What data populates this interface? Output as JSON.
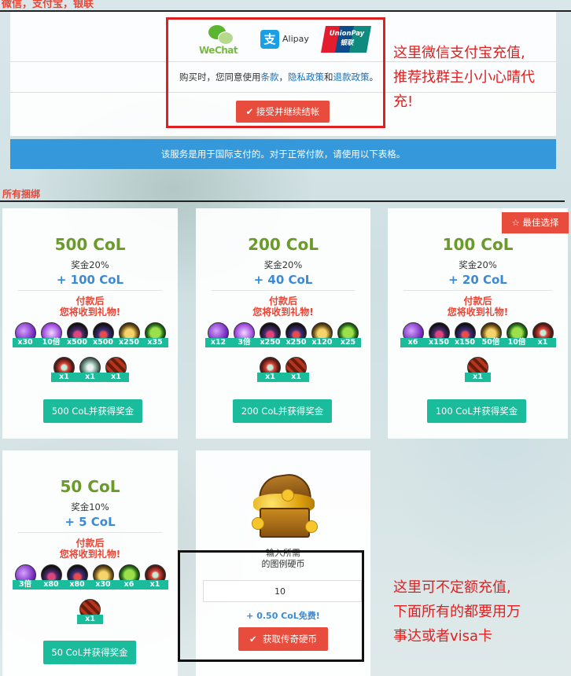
{
  "topbar": {
    "methods": "微信，支付宝，银联",
    "user": "",
    "nav": ""
  },
  "payment": {
    "logos": {
      "wechat": "WeChat",
      "alipay": "Alipay",
      "unionpay_en": "UnionPay",
      "unionpay_cn": "银联",
      "alipay_glyph": "支"
    },
    "agree_prefix": "购买时，您同意使用",
    "terms": "条款",
    "sep1": "，",
    "privacy": "隐私政策",
    "and": "和",
    "refund": "退款政策",
    "period": "。",
    "accept_button": "接受并继续结帐",
    "check_icon": "✔"
  },
  "annotations": {
    "top_line1": "这里微信支付宝充值,",
    "top_line2": "推荐找群主小小心晴代",
    "top_line3": "充!",
    "bottom_line1": "这里可不定额充值,",
    "bottom_line2": "下面所有的都要用万",
    "bottom_line3": "事达或者visa卡"
  },
  "notice": "该服务是用于国际支付的。对于正常付款，请使用以下表格。",
  "section_title": "所有捆绑",
  "best_choice": {
    "icon": "☆",
    "label": "最佳选择"
  },
  "gift_text_line1": "付款后",
  "gift_text_line2": "您将收到礼物!",
  "bundles": [
    {
      "col": "500 CoL",
      "bonus": "奖金20%",
      "plus": "+ 100 CoL",
      "buy": "500 CoL并获得奖金",
      "row1": [
        {
          "icon": "purple",
          "qty": "x30"
        },
        {
          "icon": "purple2",
          "qty": "10倍"
        },
        {
          "icon": "potion",
          "qty": "x500"
        },
        {
          "icon": "potion2",
          "qty": "x500"
        },
        {
          "icon": "cup",
          "qty": "x250"
        },
        {
          "icon": "leaf",
          "qty": "x35"
        }
      ],
      "row2": [
        {
          "icon": "scroll",
          "qty": "x1"
        },
        {
          "icon": "swirl",
          "qty": "x1"
        },
        {
          "icon": "bar",
          "qty": "x1"
        }
      ]
    },
    {
      "col": "200 CoL",
      "bonus": "奖金20%",
      "plus": "+ 40 CoL",
      "buy": "200 CoL并获得奖金",
      "row1": [
        {
          "icon": "purple",
          "qty": "x12"
        },
        {
          "icon": "purple2",
          "qty": "3倍"
        },
        {
          "icon": "potion",
          "qty": "x250"
        },
        {
          "icon": "potion2",
          "qty": "x250"
        },
        {
          "icon": "cup",
          "qty": "x120"
        },
        {
          "icon": "leaf",
          "qty": "x25"
        }
      ],
      "row2": [
        {
          "icon": "scroll",
          "qty": "x1"
        },
        {
          "icon": "bar",
          "qty": "x1"
        }
      ]
    },
    {
      "col": "100 CoL",
      "bonus": "奖金20%",
      "plus": "+ 20 CoL",
      "buy": "100 CoL并获得奖金",
      "row1": [
        {
          "icon": "purple",
          "qty": "x6"
        },
        {
          "icon": "potion",
          "qty": "x150"
        },
        {
          "icon": "potion2",
          "qty": "x150"
        },
        {
          "icon": "cup",
          "qty": "50倍"
        },
        {
          "icon": "leaf",
          "qty": "10倍"
        },
        {
          "icon": "scroll",
          "qty": "x1"
        }
      ],
      "row2": [
        {
          "icon": "bar",
          "qty": "x1"
        }
      ]
    },
    {
      "col": "50 CoL",
      "bonus": "奖金10%",
      "plus": "+ 5 CoL",
      "buy": "50 CoL并获得奖金",
      "row1": [
        {
          "icon": "purple",
          "qty": "3倍"
        },
        {
          "icon": "potion",
          "qty": "x80"
        },
        {
          "icon": "potion2",
          "qty": "x80"
        },
        {
          "icon": "cup",
          "qty": "x30"
        },
        {
          "icon": "leaf",
          "qty": "x6"
        },
        {
          "icon": "scroll",
          "qty": "x1"
        }
      ],
      "row2": [
        {
          "icon": "bar",
          "qty": "x1"
        }
      ]
    }
  ],
  "custom": {
    "label_line1": "输入所需",
    "label_line2": "的图例硬币",
    "value": "10",
    "bonus": "+ 0.50 CoL免费!",
    "button": "获取传奇硬币",
    "check_icon": "✔"
  }
}
